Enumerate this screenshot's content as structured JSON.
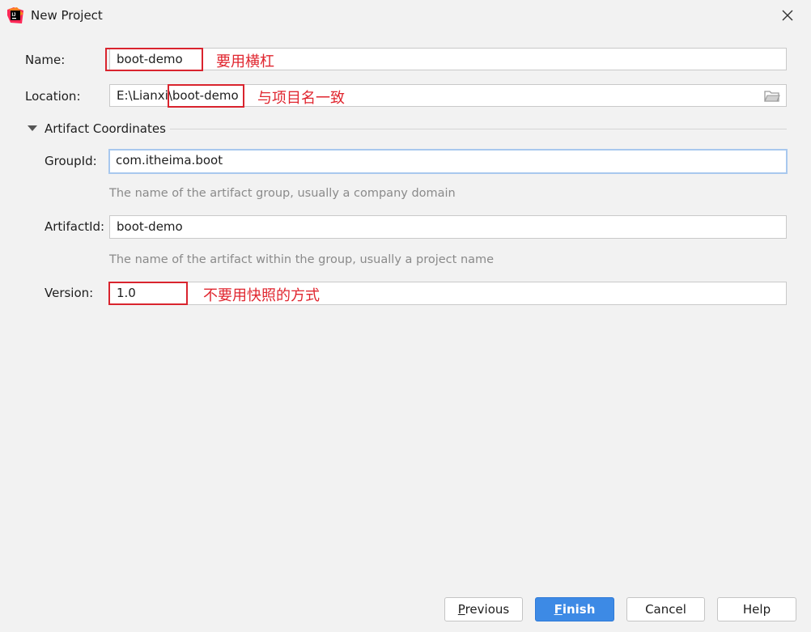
{
  "window": {
    "title": "New Project",
    "icon": "intellij-idea-icon"
  },
  "form": {
    "name": {
      "label": "Name:",
      "value": "boot-demo",
      "annotation": "要用横杠"
    },
    "location": {
      "label": "Location:",
      "prefix": "E:\\Lianxi\\",
      "highlight": "boot-demo",
      "annotation": "与项目名一致",
      "browse_icon": "folder-icon"
    },
    "section": {
      "title": "Artifact Coordinates",
      "expanded": true
    },
    "group_id": {
      "label": "GroupId:",
      "value": "com.itheima.boot",
      "hint": "The name of the artifact group, usually a company domain"
    },
    "artifact_id": {
      "label": "ArtifactId:",
      "value": "boot-demo",
      "hint": "The name of the artifact within the group, usually a project name"
    },
    "version": {
      "label": "Version:",
      "value": "1.0",
      "annotation": "不要用快照的方式"
    }
  },
  "buttons": {
    "previous": {
      "mnemonic": "P",
      "rest": "revious"
    },
    "finish": {
      "mnemonic": "F",
      "rest": "inish"
    },
    "cancel": "Cancel",
    "help": "Help"
  },
  "colors": {
    "accent": "#3d8ae5",
    "annotation": "#e0262f",
    "focus": "#a8c8ee"
  }
}
